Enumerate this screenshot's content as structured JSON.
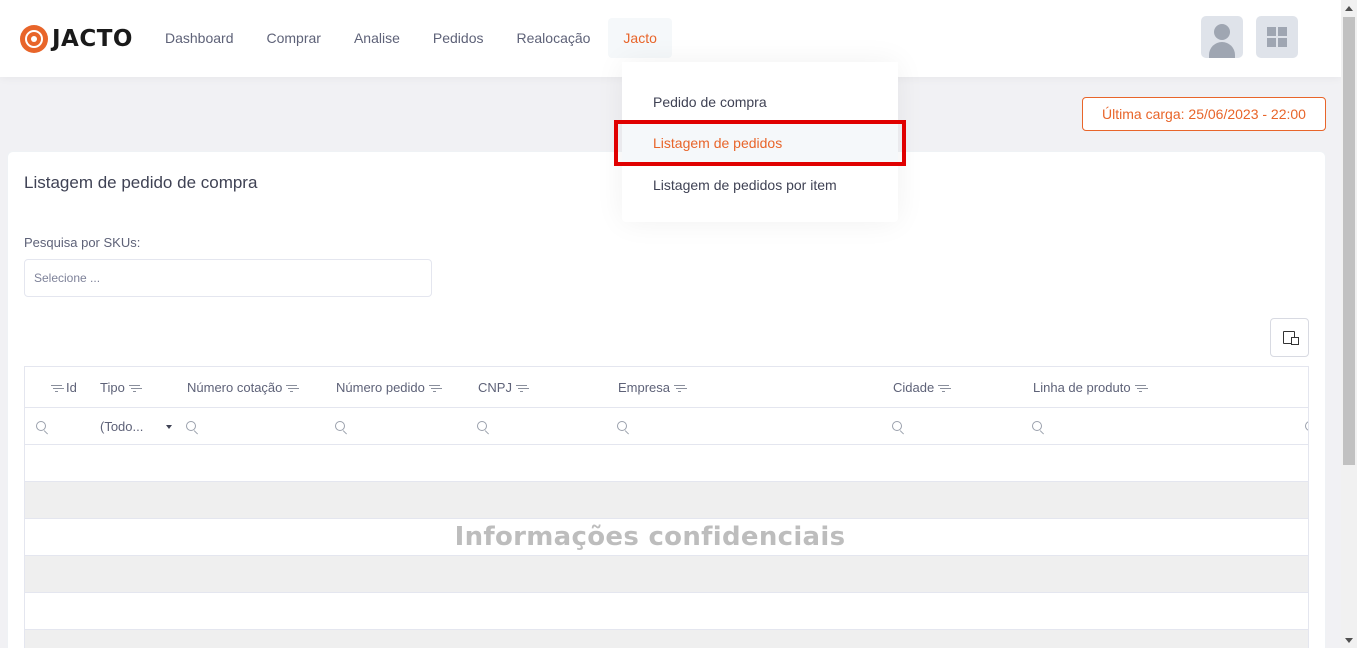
{
  "brand": {
    "name": "JACTO",
    "accent": "#e8652a"
  },
  "nav": {
    "items": [
      {
        "label": "Dashboard"
      },
      {
        "label": "Comprar"
      },
      {
        "label": "Analise"
      },
      {
        "label": "Pedidos"
      },
      {
        "label": "Realocação"
      },
      {
        "label": "Jacto",
        "active": true
      }
    ]
  },
  "header": {
    "user_icon": "user-avatar-icon",
    "apps_icon": "apps-grid-icon"
  },
  "dropdown": {
    "items": [
      {
        "label": "Pedido de compra"
      },
      {
        "label": "Listagem de pedidos",
        "highlighted": true
      },
      {
        "label": "Listagem de pedidos por item"
      }
    ]
  },
  "last_load": {
    "text": "Última carga: 25/06/2023 - 22:00"
  },
  "page": {
    "title": "Listagem de pedido de compra",
    "search": {
      "label": "Pesquisa por SKUs:",
      "placeholder": "Selecione ..."
    },
    "export_icon": "export-excel-icon"
  },
  "grid": {
    "columns": [
      {
        "label": "Id"
      },
      {
        "label": "Tipo"
      },
      {
        "label": "Número cotação"
      },
      {
        "label": "Número pedido"
      },
      {
        "label": "CNPJ"
      },
      {
        "label": "Empresa"
      },
      {
        "label": "Cidade"
      },
      {
        "label": "Linha de produto"
      }
    ],
    "tipo_filter_value": "(Todo...",
    "overlay_text": "Informações confidenciais"
  }
}
